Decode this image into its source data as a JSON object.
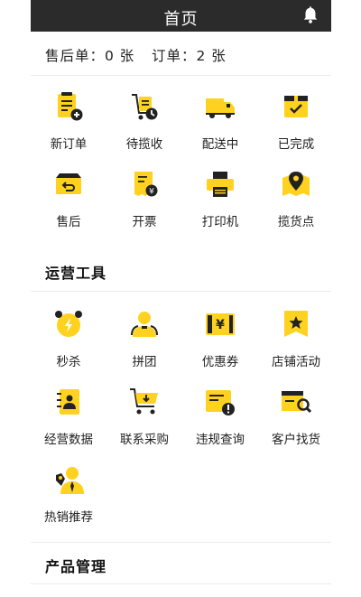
{
  "header": {
    "title": "首页",
    "bell_icon": "bell-icon"
  },
  "stats": {
    "after_sale": "售后单：0 张",
    "orders": "订单：2 张"
  },
  "order_grid": [
    {
      "label": "新订单",
      "icon": "new-order-icon"
    },
    {
      "label": "待揽收",
      "icon": "pickup-cart-icon"
    },
    {
      "label": "配送中",
      "icon": "truck-icon"
    },
    {
      "label": "已完成",
      "icon": "box-check-icon"
    },
    {
      "label": "售后",
      "icon": "return-box-icon"
    },
    {
      "label": "开票",
      "icon": "invoice-icon"
    },
    {
      "label": "打印机",
      "icon": "printer-icon"
    },
    {
      "label": "揽货点",
      "icon": "map-pin-icon"
    }
  ],
  "sections": {
    "ops_tools": "运营工具",
    "product_mgmt": "产品管理"
  },
  "tools_grid": [
    {
      "label": "秒杀",
      "icon": "alarm-clock-icon"
    },
    {
      "label": "拼团",
      "icon": "group-users-icon"
    },
    {
      "label": "优惠券",
      "icon": "coupon-icon"
    },
    {
      "label": "店铺活动",
      "icon": "star-flag-icon"
    },
    {
      "label": "经营数据",
      "icon": "data-book-icon"
    },
    {
      "label": "联系采购",
      "icon": "shopping-cart-icon"
    },
    {
      "label": "违规查询",
      "icon": "violation-card-icon"
    },
    {
      "label": "客户找货",
      "icon": "box-search-icon"
    },
    {
      "label": "热销推荐",
      "icon": "hot-recommend-icon"
    }
  ],
  "colors": {
    "accent": "#ffd21f",
    "dark": "#222222",
    "header_bg": "#2b2b2b"
  }
}
